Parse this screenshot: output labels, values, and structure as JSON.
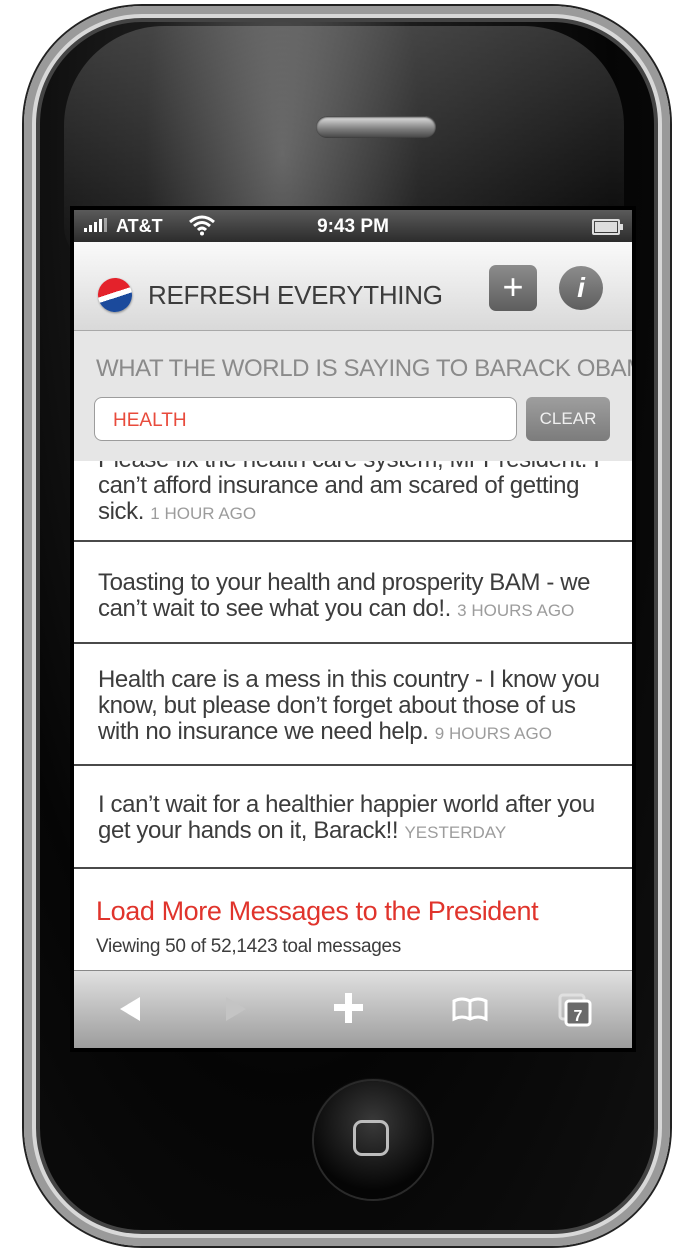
{
  "status_bar": {
    "carrier": "AT&T",
    "time": "9:43 PM"
  },
  "header": {
    "title": "REFRESH EVERYTHING",
    "add_label": "+",
    "info_label": "i"
  },
  "filter": {
    "heading": "WHAT THE WORLD IS SAYING TO BARACK OBAMA",
    "search_value": "HEALTH",
    "clear_label": "CLEAR"
  },
  "messages": [
    {
      "text": "Please fix the health care system, Mr President. I can’t afford insurance and am scared of getting sick.",
      "ago": "1 HOUR AGO"
    },
    {
      "text": "Toasting to your health and prosperity BAM - we can’t wait to see what you can do!.",
      "ago": "3 HOURS AGO"
    },
    {
      "text": "Health care is a mess in this country - I know you know, but please don’t forget about those of us with no insurance we need help.",
      "ago": "9 HOURS AGO"
    },
    {
      "text": "I can’t wait for a healthier happier world after you get your hands on it, Barack!!",
      "ago": "YESTERDAY"
    }
  ],
  "footer": {
    "load_more": "Load More Messages to the President",
    "viewing": "Viewing 50 of 52,1423 toal messages"
  },
  "toolbar": {
    "pages_count": "7",
    "icons": [
      "back-icon",
      "forward-icon",
      "add-bookmark-icon",
      "bookmarks-icon",
      "pages-icon"
    ]
  },
  "colors": {
    "accent_red": "#e0342c",
    "search_text": "#e84b3c",
    "pepsi_blue": "#1b4a9c",
    "pepsi_red": "#e4222b"
  }
}
